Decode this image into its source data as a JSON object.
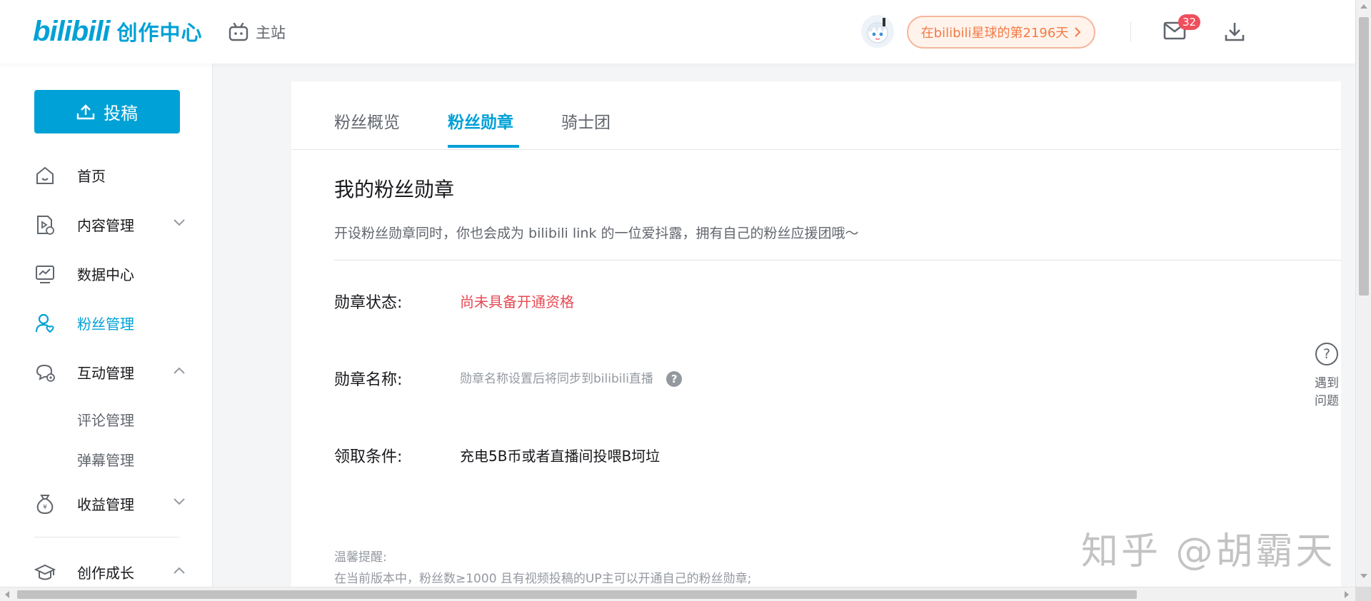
{
  "header": {
    "logo_mark": "bilibili",
    "logo_text": "创作中心",
    "mainsite_label": "主站",
    "days_label": "在bilibili星球的第2196天",
    "mail_badge": "32"
  },
  "sidebar": {
    "upload_label": "投稿",
    "items": [
      {
        "label": "首页"
      },
      {
        "label": "内容管理"
      },
      {
        "label": "数据中心"
      },
      {
        "label": "粉丝管理"
      },
      {
        "label": "互动管理"
      },
      {
        "label": "收益管理"
      },
      {
        "label": "创作成长"
      }
    ],
    "sub_items": [
      {
        "label": "评论管理"
      },
      {
        "label": "弹幕管理"
      }
    ]
  },
  "tabs": [
    {
      "label": "粉丝概览"
    },
    {
      "label": "粉丝勋章"
    },
    {
      "label": "骑士团"
    }
  ],
  "section": {
    "title": "我的粉丝勋章",
    "desc": "开设粉丝勋章同时，你也会成为 bilibili link 的一位爱抖露，拥有自己的粉丝应援团哦～"
  },
  "rows": {
    "status_label": "勋章状态:",
    "status_value": "尚未具备开通资格",
    "name_label": "勋章名称:",
    "name_hint": "勋章名称设置后将同步到bilibili直播",
    "name_help_icon": "?",
    "cond_label": "领取条件:",
    "cond_value": "充电5B币或者直播间投喂B坷垃"
  },
  "tips": {
    "title": "温馨提醒:",
    "line1": "在当前版本中，粉丝数≥1000 且有视频投稿的UP主可以开通自己的粉丝勋章;"
  },
  "help_float": {
    "icon": "?",
    "line1": "遇到",
    "line2": "问题"
  },
  "watermark": "知乎 @胡霸天",
  "colors": {
    "brand": "#00a1d6",
    "status_red": "#e64a53",
    "days_orange": "#f37a45",
    "badge_red": "#ef4f5c"
  }
}
